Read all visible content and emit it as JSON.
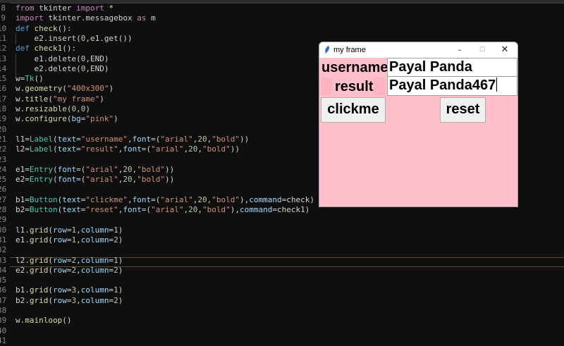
{
  "editor": {
    "gutter_numbers": [
      "8",
      "9",
      "10",
      "11",
      "12",
      "13",
      "14",
      "15",
      "16",
      "17",
      "18",
      "19",
      "20",
      "21",
      "22",
      "23",
      "24",
      "25",
      "26",
      "27",
      "28",
      "29",
      "30",
      "31",
      "32",
      "33",
      "34",
      "35",
      "36",
      "37",
      "38",
      "39",
      "40",
      "41"
    ],
    "lines": [
      {
        "tokens": [
          [
            "kw",
            "from"
          ],
          [
            "plain",
            " tkinter "
          ],
          [
            "kw",
            "import"
          ],
          [
            "plain",
            " *"
          ]
        ]
      },
      {
        "tokens": [
          [
            "kw",
            "import"
          ],
          [
            "plain",
            " tkinter.messagebox "
          ],
          [
            "kw",
            "as"
          ],
          [
            "plain",
            " m"
          ]
        ]
      },
      {
        "tokens": [
          [
            "kwb",
            "def"
          ],
          [
            "plain",
            " "
          ],
          [
            "fn",
            "check"
          ],
          [
            "plain",
            "():"
          ]
        ]
      },
      {
        "tokens": [
          [
            "plain",
            "    e2.insert("
          ],
          [
            "num",
            "0"
          ],
          [
            "plain",
            ",e1.get())"
          ]
        ]
      },
      {
        "tokens": [
          [
            "kwb",
            "def"
          ],
          [
            "plain",
            " "
          ],
          [
            "fn",
            "check1"
          ],
          [
            "plain",
            "():"
          ]
        ]
      },
      {
        "tokens": [
          [
            "plain",
            "    e1.delete("
          ],
          [
            "num",
            "0"
          ],
          [
            "plain",
            ",END)"
          ]
        ]
      },
      {
        "tokens": [
          [
            "plain",
            "    e2.delete("
          ],
          [
            "num",
            "0"
          ],
          [
            "plain",
            ",END)"
          ]
        ]
      },
      {
        "tokens": [
          [
            "plain",
            "w="
          ],
          [
            "cls",
            "Tk"
          ],
          [
            "plain",
            "()"
          ]
        ]
      },
      {
        "tokens": [
          [
            "plain",
            "w."
          ],
          [
            "fn",
            "geometry"
          ],
          [
            "plain",
            "("
          ],
          [
            "str",
            "\"400x300\""
          ],
          [
            "plain",
            ")"
          ]
        ]
      },
      {
        "tokens": [
          [
            "plain",
            "w."
          ],
          [
            "fn",
            "title"
          ],
          [
            "plain",
            "("
          ],
          [
            "str",
            "\"my frame\""
          ],
          [
            "plain",
            ")"
          ]
        ]
      },
      {
        "tokens": [
          [
            "plain",
            "w."
          ],
          [
            "fn",
            "resizable"
          ],
          [
            "plain",
            "("
          ],
          [
            "num",
            "0"
          ],
          [
            "plain",
            ","
          ],
          [
            "num",
            "0"
          ],
          [
            "plain",
            ")"
          ]
        ]
      },
      {
        "tokens": [
          [
            "plain",
            "w."
          ],
          [
            "fn",
            "configure"
          ],
          [
            "plain",
            "("
          ],
          [
            "var",
            "bg"
          ],
          [
            "plain",
            "="
          ],
          [
            "str",
            "\"pink\""
          ],
          [
            "plain",
            ")"
          ]
        ]
      },
      {
        "tokens": []
      },
      {
        "tokens": [
          [
            "plain",
            "l1="
          ],
          [
            "cls",
            "Label"
          ],
          [
            "plain",
            "("
          ],
          [
            "var",
            "text"
          ],
          [
            "plain",
            "="
          ],
          [
            "str",
            "\"username\""
          ],
          [
            "plain",
            ","
          ],
          [
            "var",
            "font"
          ],
          [
            "plain",
            "=("
          ],
          [
            "str",
            "\"arial\""
          ],
          [
            "plain",
            ","
          ],
          [
            "num",
            "20"
          ],
          [
            "plain",
            ","
          ],
          [
            "str",
            "\"bold\""
          ],
          [
            "plain",
            "))"
          ]
        ]
      },
      {
        "tokens": [
          [
            "plain",
            "l2="
          ],
          [
            "cls",
            "Label"
          ],
          [
            "plain",
            "("
          ],
          [
            "var",
            "text"
          ],
          [
            "plain",
            "="
          ],
          [
            "str",
            "\"result\""
          ],
          [
            "plain",
            ","
          ],
          [
            "var",
            "font"
          ],
          [
            "plain",
            "=("
          ],
          [
            "str",
            "\"arial\""
          ],
          [
            "plain",
            ","
          ],
          [
            "num",
            "20"
          ],
          [
            "plain",
            ","
          ],
          [
            "str",
            "\"bold\""
          ],
          [
            "plain",
            "))"
          ]
        ]
      },
      {
        "tokens": []
      },
      {
        "tokens": [
          [
            "plain",
            "e1="
          ],
          [
            "cls",
            "Entry"
          ],
          [
            "plain",
            "("
          ],
          [
            "var",
            "font"
          ],
          [
            "plain",
            "=("
          ],
          [
            "str",
            "\"arial\""
          ],
          [
            "plain",
            ","
          ],
          [
            "num",
            "20"
          ],
          [
            "plain",
            ","
          ],
          [
            "str",
            "\"bold\""
          ],
          [
            "plain",
            "))"
          ]
        ]
      },
      {
        "tokens": [
          [
            "plain",
            "e2="
          ],
          [
            "cls",
            "Entry"
          ],
          [
            "plain",
            "("
          ],
          [
            "var",
            "font"
          ],
          [
            "plain",
            "=("
          ],
          [
            "str",
            "\"arial\""
          ],
          [
            "plain",
            ","
          ],
          [
            "num",
            "20"
          ],
          [
            "plain",
            ","
          ],
          [
            "str",
            "\"bold\""
          ],
          [
            "plain",
            "))"
          ]
        ]
      },
      {
        "tokens": []
      },
      {
        "tokens": [
          [
            "plain",
            "b1="
          ],
          [
            "cls",
            "Button"
          ],
          [
            "plain",
            "("
          ],
          [
            "var",
            "text"
          ],
          [
            "plain",
            "="
          ],
          [
            "str",
            "\"clickme\""
          ],
          [
            "plain",
            ","
          ],
          [
            "var",
            "font"
          ],
          [
            "plain",
            "=("
          ],
          [
            "str",
            "\"arial\""
          ],
          [
            "plain",
            ","
          ],
          [
            "num",
            "20"
          ],
          [
            "plain",
            ","
          ],
          [
            "str",
            "\"bold\""
          ],
          [
            "plain",
            "),"
          ],
          [
            "var",
            "command"
          ],
          [
            "plain",
            "=check)"
          ]
        ]
      },
      {
        "tokens": [
          [
            "plain",
            "b2="
          ],
          [
            "cls",
            "Button"
          ],
          [
            "plain",
            "("
          ],
          [
            "var",
            "text"
          ],
          [
            "plain",
            "="
          ],
          [
            "str",
            "\"reset\""
          ],
          [
            "plain",
            ","
          ],
          [
            "var",
            "font"
          ],
          [
            "plain",
            "=("
          ],
          [
            "str",
            "\"arial\""
          ],
          [
            "plain",
            ","
          ],
          [
            "num",
            "20"
          ],
          [
            "plain",
            ","
          ],
          [
            "str",
            "\"bold\""
          ],
          [
            "plain",
            "),"
          ],
          [
            "var",
            "command"
          ],
          [
            "plain",
            "=check1)"
          ]
        ]
      },
      {
        "tokens": []
      },
      {
        "tokens": [
          [
            "plain",
            "l1."
          ],
          [
            "fn",
            "grid"
          ],
          [
            "plain",
            "("
          ],
          [
            "var",
            "row"
          ],
          [
            "plain",
            "="
          ],
          [
            "num",
            "1"
          ],
          [
            "plain",
            ","
          ],
          [
            "var",
            "column"
          ],
          [
            "plain",
            "="
          ],
          [
            "num",
            "1"
          ],
          [
            "plain",
            ")"
          ]
        ]
      },
      {
        "tokens": [
          [
            "plain",
            "e1."
          ],
          [
            "fn",
            "grid"
          ],
          [
            "plain",
            "("
          ],
          [
            "var",
            "row"
          ],
          [
            "plain",
            "="
          ],
          [
            "num",
            "1"
          ],
          [
            "plain",
            ","
          ],
          [
            "var",
            "column"
          ],
          [
            "plain",
            "="
          ],
          [
            "num",
            "2"
          ],
          [
            "plain",
            ")"
          ]
        ]
      },
      {
        "tokens": []
      },
      {
        "tokens": [
          [
            "plain",
            "l2."
          ],
          [
            "fn",
            "grid"
          ],
          [
            "plain",
            "("
          ],
          [
            "var",
            "row"
          ],
          [
            "plain",
            "="
          ],
          [
            "num",
            "2"
          ],
          [
            "plain",
            ","
          ],
          [
            "var",
            "column"
          ],
          [
            "plain",
            "="
          ],
          [
            "num",
            "1"
          ],
          [
            "plain",
            ")"
          ]
        ]
      },
      {
        "tokens": [
          [
            "plain",
            "e2."
          ],
          [
            "fn",
            "grid"
          ],
          [
            "plain",
            "("
          ],
          [
            "var",
            "row"
          ],
          [
            "plain",
            "="
          ],
          [
            "num",
            "2"
          ],
          [
            "plain",
            ","
          ],
          [
            "var",
            "column"
          ],
          [
            "plain",
            "="
          ],
          [
            "num",
            "2"
          ],
          [
            "plain",
            ")"
          ]
        ]
      },
      {
        "tokens": []
      },
      {
        "tokens": [
          [
            "plain",
            "b1."
          ],
          [
            "fn",
            "grid"
          ],
          [
            "plain",
            "("
          ],
          [
            "var",
            "row"
          ],
          [
            "plain",
            "="
          ],
          [
            "num",
            "3"
          ],
          [
            "plain",
            ","
          ],
          [
            "var",
            "column"
          ],
          [
            "plain",
            "="
          ],
          [
            "num",
            "1"
          ],
          [
            "plain",
            ")"
          ]
        ]
      },
      {
        "tokens": [
          [
            "plain",
            "b2."
          ],
          [
            "fn",
            "grid"
          ],
          [
            "plain",
            "("
          ],
          [
            "var",
            "row"
          ],
          [
            "plain",
            "="
          ],
          [
            "num",
            "3"
          ],
          [
            "plain",
            ","
          ],
          [
            "var",
            "column"
          ],
          [
            "plain",
            "="
          ],
          [
            "num",
            "2"
          ],
          [
            "plain",
            ")"
          ]
        ]
      },
      {
        "tokens": []
      },
      {
        "tokens": [
          [
            "plain",
            "w."
          ],
          [
            "fn",
            "mainloop"
          ],
          [
            "plain",
            "()"
          ]
        ]
      },
      {
        "tokens": []
      },
      {
        "tokens": []
      }
    ]
  },
  "tk_window": {
    "title": "my frame",
    "icon": "tk-feather-icon",
    "controls": {
      "minimize": "–",
      "maximize": "☐",
      "close": "✕"
    },
    "bg": "#ffc0cb",
    "label_username": "username",
    "label_result": "result",
    "entry_username_value": "Payal Panda",
    "entry_result_value": "Payal Panda467",
    "button_clickme": "clickme",
    "button_reset": "reset"
  }
}
